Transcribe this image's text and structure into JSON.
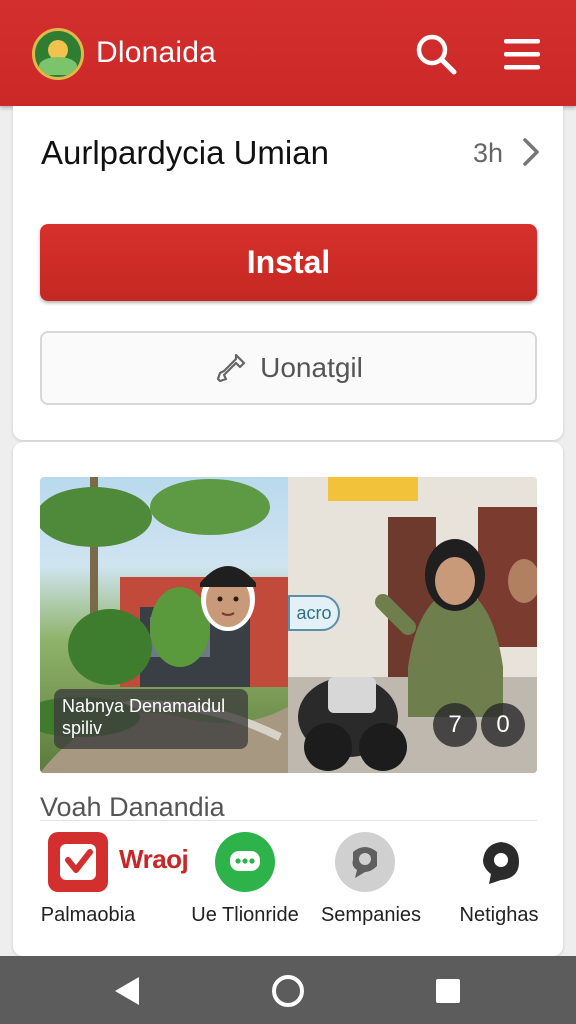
{
  "header": {
    "app_title": "Dlonaida",
    "logo_icon": "app-logo",
    "search_icon": "search-icon",
    "menu_icon": "hamburger-menu-icon",
    "color": "#cc2828"
  },
  "app": {
    "name": "Aurlpardycia Umian",
    "age": "3h",
    "install_label": "Instal",
    "secondary_label": "Uonatgil",
    "accent": "#d32f2f"
  },
  "gallery": {
    "caption_line1": "Nabnya Denamaidul",
    "caption_line2": "spiliv",
    "tag_text": "acro",
    "badge_a": "7",
    "badge_b": "0"
  },
  "section": {
    "title": "Voah Danandia",
    "brand_text": "Wraoj",
    "apps": [
      {
        "label": "Palmaobia",
        "icon": "red-check-icon",
        "color": "#d32f2f"
      },
      {
        "label": "Ue Tlionride",
        "icon": "green-chat-icon",
        "color": "#2db34a"
      },
      {
        "label": "Sempanies",
        "icon": "gray-chat-icon",
        "color": "#9e9e9e"
      },
      {
        "label": "Netighas",
        "icon": "dark-chat-icon",
        "color": "#2b2b2b"
      }
    ]
  },
  "system_nav": {
    "back_icon": "back-triangle-icon",
    "home_icon": "home-circle-icon",
    "recents_icon": "recents-square-icon"
  }
}
